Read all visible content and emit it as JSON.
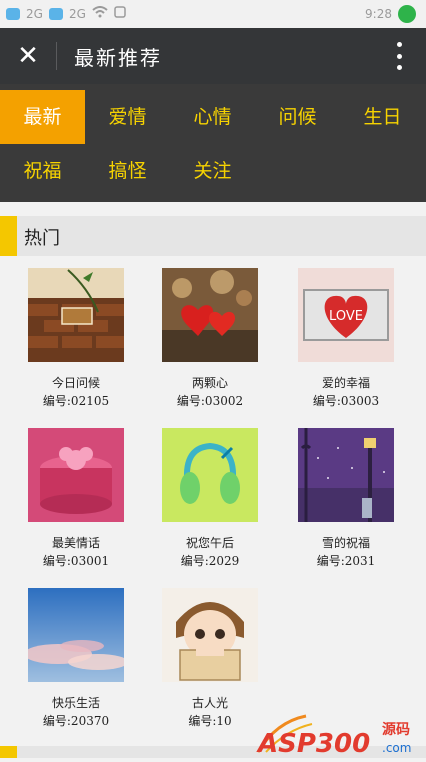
{
  "status": {
    "left_texts": [
      "2G",
      "2G"
    ],
    "time": "9:28"
  },
  "titlebar": {
    "close_icon": "close-icon",
    "title": "最新推荐",
    "more_icon": "more-vertical-icon"
  },
  "categories": [
    "最新",
    "爱情",
    "心情",
    "问候",
    "生日",
    "祝福",
    "搞怪",
    "关注"
  ],
  "active_category": "最新",
  "section": {
    "title": "热门"
  },
  "items": [
    {
      "name": "今日问候",
      "num": "编号:02105"
    },
    {
      "name": "两颗心",
      "num": "编号:03002"
    },
    {
      "name": "爱的幸福",
      "num": "编号:03003"
    },
    {
      "name": "最美情话",
      "num": "编号:03001"
    },
    {
      "name": "祝您午后",
      "num": "编号:2029"
    },
    {
      "name": "雪的祝福",
      "num": "编号:2031"
    },
    {
      "name": "快乐生活",
      "num": "编号:20370"
    },
    {
      "name": "古人光",
      "num": "编号:10"
    }
  ],
  "watermark": {
    "text": "ASP300",
    "suffix": "源码",
    "url_text": ".com"
  }
}
